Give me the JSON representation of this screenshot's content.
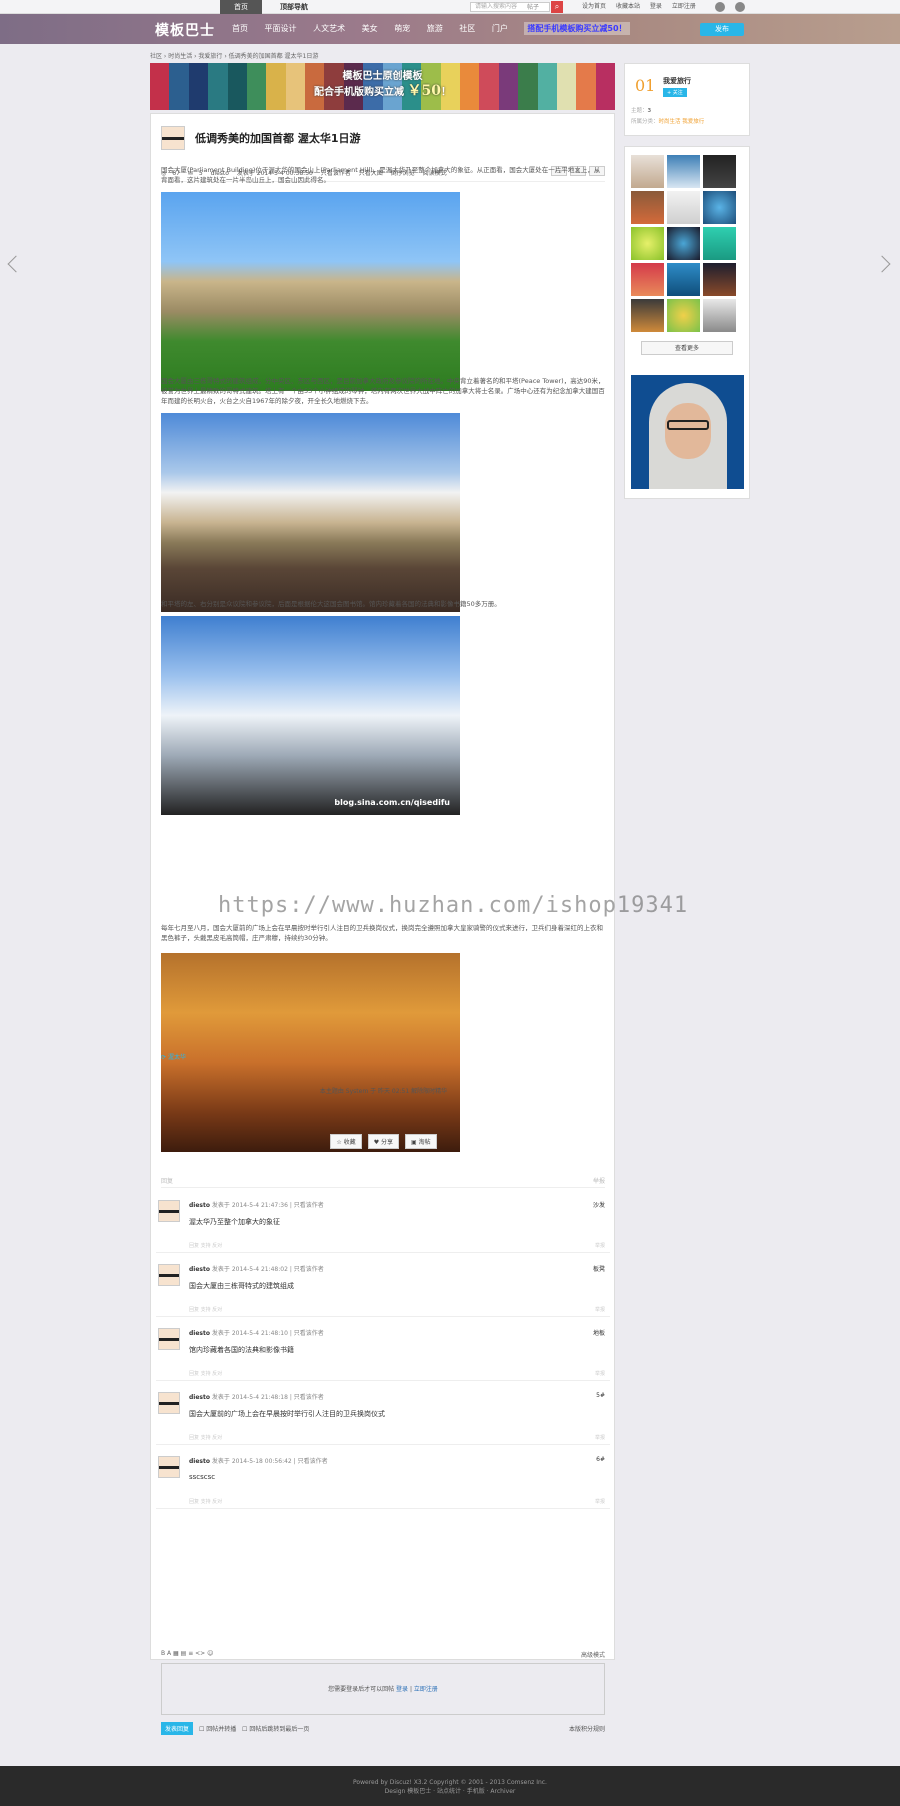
{
  "topbar": {
    "tab_home": "首页",
    "tab_nav": "顶部导航",
    "search_placeholder": "请输入搜索内容",
    "search_type": "帖子",
    "links": [
      "设为首页",
      "收藏本站",
      "登录",
      "立即注册"
    ]
  },
  "nav": {
    "logo": "模板巴士",
    "items": [
      "首页",
      "平面设计",
      "人文艺术",
      "美女",
      "萌宠",
      "旅游",
      "社区",
      "门户"
    ],
    "highlight": "搭配手机模板购买立减50！",
    "post_button": "发布"
  },
  "breadcrumb": "社区 › 时尚生活 › 我爱旅行 › 低调秀美的加国首都 渥太华1日游",
  "banner": {
    "line1": "模板巴士原创模板",
    "line2": "配合手机版购买立减",
    "price": "￥50",
    "end": "！"
  },
  "post": {
    "title": "低调秀美的加国首都 渥太华1日游",
    "views": "67",
    "replies": "5",
    "author": "diesto",
    "published": "发表于 2014-5-4 00:38:50",
    "meta_links": [
      "只看该作者",
      "只看大图",
      "倒序浏览",
      "阅读模式"
    ],
    "paragraphs": [
      "国会大厦(Parliament Building)位于渥太华的国会山上(Parliament Hill)，是渥太华乃至整个加拿大的象征。从正面看，国会大厦处在一片平地之上，从背面看，这片建筑处在一片半岛山丘上，国会山因此得名。",
      "国会大厦由三栋哥特式的建筑组成，分中央区、东区与西区，是目前加拿大政府及参议院的所在地。中央背立着著名的和平塔(Peace Tower)，高达90米，被誉为世界上最精致的哥特式建筑。塔上有一个由53个小钟组成的琴钟，塔内有两次世界大战中阵亡的加拿大将士名录。广场中心还有为纪念加拿大建国百年而建的长明火台，火台之火自1967年的除夕夜，开全长久地燃烧下去。",
      "和平塔的左、右分别是众议院和参议院，后面是根据伦大这国会图书馆。馆内珍藏着各国的法典和影像书籍50多万册。",
      "每年七月至八月，国会大厦前的广场上会在早晨按时举行引人注目的卫兵换岗仪式，换岗完全遵照加拿大皇家骑警的仪式来进行，卫兵们身着深红的上衣和黑色裤子，头戴黑皮毛高筒帽，庄严肃穆，持续约30分钟。"
    ],
    "photo_caption": "blog.sina.com.cn/qisedifu",
    "watermark": "https://www.huzhan.com/ishop19341",
    "tag": "渥太华",
    "notice": "本主题由 System 于 昨天 02:51 解除限时精华",
    "actions": [
      "收藏",
      "分享",
      "淘帖"
    ],
    "reply_bar_left": "回复",
    "reply_bar_right": "举报"
  },
  "comments": [
    {
      "author": "diesto",
      "time": "发表于 2014-5-4 21:47:36",
      "link": "只看该作者",
      "floor": "沙发",
      "text": "渥太华乃至整个加拿大的象征"
    },
    {
      "author": "diesto",
      "time": "发表于 2014-5-4 21:48:02",
      "link": "只看该作者",
      "floor": "板凳",
      "text": "国会大厦由三栋哥特式的建筑组成"
    },
    {
      "author": "diesto",
      "time": "发表于 2014-5-4 21:48:10",
      "link": "只看该作者",
      "floor": "地板",
      "text": "馆内珍藏着各国的法典和影像书籍"
    },
    {
      "author": "diesto",
      "time": "发表于 2014-5-4 21:48:18",
      "link": "只看该作者",
      "floor": "5#",
      "text": "国会大厦前的广场上会在早晨按时举行引人注目的卫兵换岗仪式"
    },
    {
      "author": "diesto",
      "time": "发表于 2014-5-18 00:56:42",
      "link": "只看该作者",
      "floor": "6#",
      "text": "sscscsc"
    }
  ],
  "comment_ops": "回复    支持    反对",
  "comment_report": "举报",
  "editor": {
    "toolbar": "B  A  ▦  ▤  ≡  <>  ☺",
    "advanced": "高级模式",
    "prompt": "您需要登录后才可以回帖",
    "login": "登录",
    "sep": "|",
    "register": "立即注册",
    "submit": "发表回复",
    "opt1": "回帖并转播",
    "opt2": "回帖后跳转到最后一页",
    "rule": "本版积分规则"
  },
  "sidebar": {
    "rank": "01",
    "name": "我爱旅行",
    "follow": "+ 关注",
    "themes_label": "主题：",
    "themes_value": "3",
    "cats_label": "所属分类：",
    "cats_value": "时尚生活 我爱旅行",
    "more": "查看更多"
  },
  "footer": {
    "line1": "Powered by Discuz! X3.2 Copyright © 2001 - 2013 Comsenz Inc.",
    "line2": "Design 模板巴士 · 站点统计 · 手机版 · Archiver"
  },
  "colors": {
    "accent": "#29b6e8",
    "rank": "#f0a030",
    "footer": "#2a2a2a"
  }
}
